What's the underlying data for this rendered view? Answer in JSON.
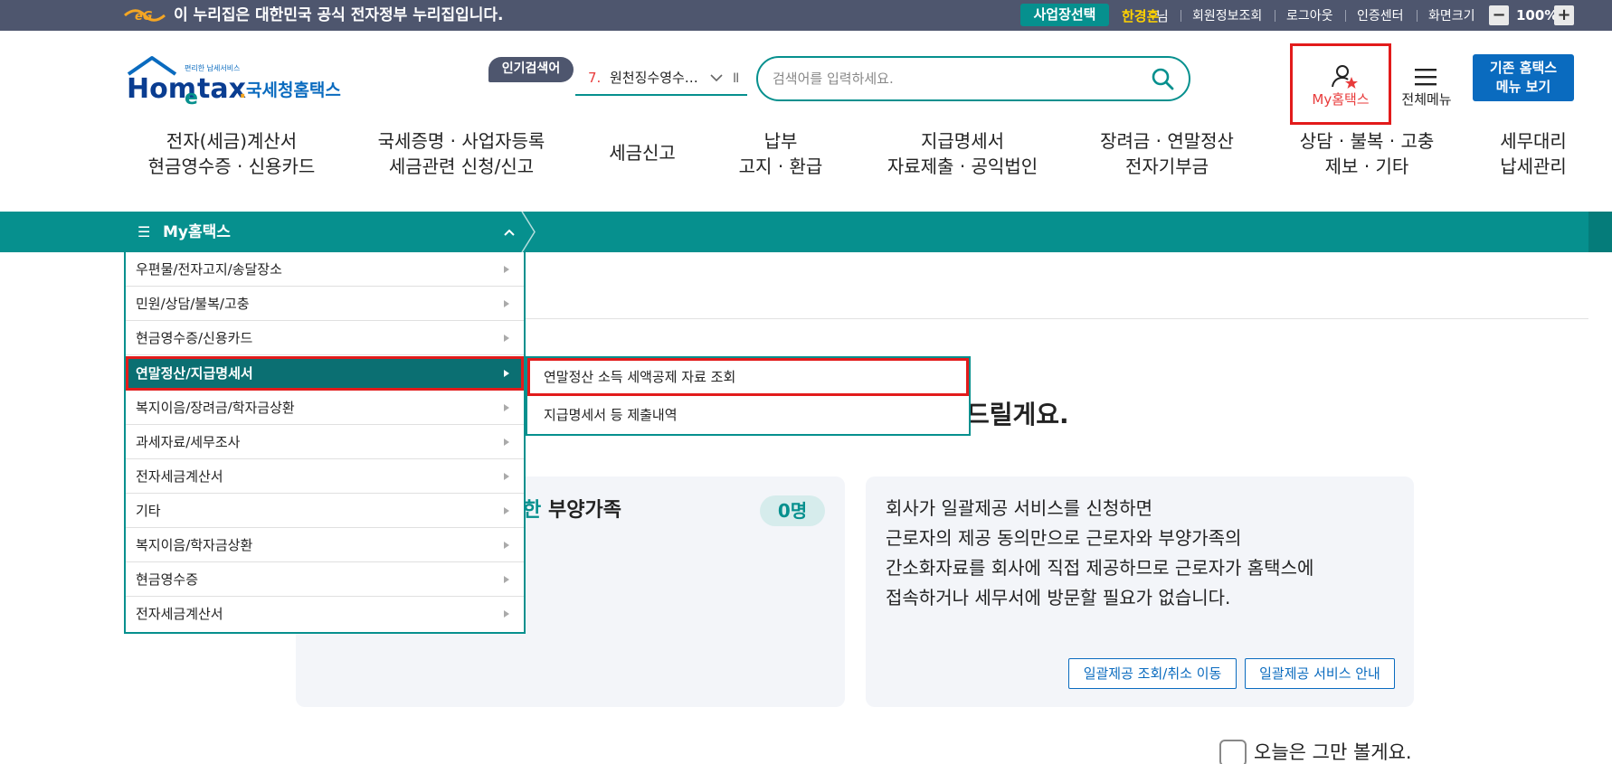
{
  "gov_banner": {
    "logo": "gov-eg-logo",
    "text": "이 누리집은 대한민국 공식 전자정부 누리집입니다.",
    "business_select": "사업장선택",
    "user_name": "한경훈",
    "user_suffix": "님",
    "links": [
      "회원정보조회",
      "로그아웃",
      "인증센터",
      "화면크기"
    ],
    "zoom_minus": "−",
    "zoom_value": "100%",
    "zoom_plus": "+"
  },
  "header": {
    "logo_small_text": "편리한 납세서비스",
    "logo_text": "Hometax",
    "logo_kr": "국세청홈택스",
    "popular_label": "인기검색어",
    "popular_num": "7.",
    "popular_item": "원천징수영수…",
    "popular_pause": "II",
    "search_placeholder": "검색어를 입력하세요.",
    "myhometax_label": "My홈택스",
    "allmenu_label": "전체메뉴",
    "legacy_line1": "기존 홈택스",
    "legacy_line2": "메뉴 보기"
  },
  "gnb": [
    {
      "l1": "전자(세금)계산서",
      "l2": "현금영수증 · 신용카드"
    },
    {
      "l1": "국세증명 · 사업자등록",
      "l2": "세금관련 신청/신고"
    },
    {
      "l1": "세금신고",
      "l2": ""
    },
    {
      "l1": "납부",
      "l2": "고지 · 환급"
    },
    {
      "l1": "지급명세서",
      "l2": "자료제출 · 공익법인"
    },
    {
      "l1": "장려금 · 연말정산",
      "l2": "전자기부금"
    },
    {
      "l1": "상담 · 불복 · 고충",
      "l2": "제보 · 기타"
    },
    {
      "l1": "세무대리",
      "l2": "납세관리"
    }
  ],
  "mymenu": {
    "hamburger": "☰",
    "title": "My홈택스",
    "items": [
      "우편물/전자고지/송달장소",
      "민원/상담/불복/고충",
      "현금영수증/신용카드",
      "연말정산/지급명세서",
      "복지이음/장려금/학자금상환",
      "과세자료/세무조사",
      "전자세금계산서",
      "기타",
      "복지이음/학자금상환",
      "현금영수증",
      "전자세금계산서"
    ],
    "active_index": 3,
    "submenu": [
      "연말정산 소득 세액공제 자료 조회",
      "지급명세서 등 제출내역"
    ]
  },
  "content": {
    "headline_fragment": "드릴게요.",
    "card1_title_a": "한",
    "card1_title_b": "부양가족",
    "card1_count": "0명",
    "card2_lines": [
      "회사가 일괄제공 서비스를 신청하면",
      "근로자의 제공 동의만으로 근로자와 부양가족의",
      "간소화자료를 회사에 직접 제공하므로 근로자가 홈택스에",
      "접속하거나 세무서에 방문할 필요가 없습니다."
    ],
    "btn_lookup": "일괄제공 조회/취소 이동",
    "btn_guide": "일괄제공 서비스 안내",
    "dismiss_label": "오늘은 그만 볼게요."
  },
  "colors": {
    "teal": "#06908e",
    "gov_bar": "#4e566e",
    "highlight_red": "#e21b1b",
    "legacy_blue": "#0a6bbf"
  }
}
